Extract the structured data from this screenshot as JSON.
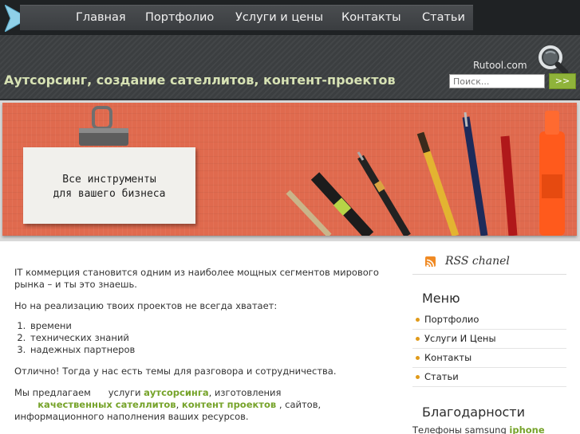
{
  "nav": {
    "items": [
      {
        "label": "Главная"
      },
      {
        "label": "Портфолио"
      },
      {
        "label": "Услуги и цены"
      },
      {
        "label": "Контакты"
      },
      {
        "label": "Статьи"
      }
    ]
  },
  "header": {
    "title": "Аутсорсинг, создание сателлитов, контент-проектов",
    "brand": "Rutool.com",
    "search_placeholder": "Поиск...",
    "search_button": ">>"
  },
  "banner": {
    "line1": "Все инструменты",
    "line2": "для вашего бизнеса"
  },
  "content": {
    "p1": "IT коммерция становится одним из наиболее мощных сегментов мирового рынка – и ты это знаешь.",
    "p2": "Но на реализацию твоих проектов не всегда хватает:",
    "list": [
      "времени",
      "технических знаний",
      "надежных партнеров"
    ],
    "p3": "Отлично! Тогда у нас есть темы для разговора и сотрудничества.",
    "p4_a": "Мы предлагаем",
    "p4_b": "услуги",
    "p4_link1": "аутсорсинга",
    "p4_c": ", изготовления",
    "p4_link2": "качественных сателлитов",
    "p4_comma": ",",
    "p4_link3": "контент проектов",
    "p4_d": ", сайтов, информационного наполнения ваших ресурсов."
  },
  "sidebar": {
    "rss_label": "RSS chanel",
    "menu_title": "Меню",
    "menu_items": [
      {
        "label": "Портфолио"
      },
      {
        "label": "Услуги И Цены"
      },
      {
        "label": "Контакты"
      },
      {
        "label": "Статьи"
      }
    ],
    "thanks_title": "Благодарности",
    "thanks_text": "Телефоны samsung",
    "thanks_link": "iphone"
  },
  "colors": {
    "accent_green": "#76a32a",
    "header_bg": "#3b3e40",
    "banner_bg": "#e06a4e",
    "bullet": "#e09a1a"
  }
}
